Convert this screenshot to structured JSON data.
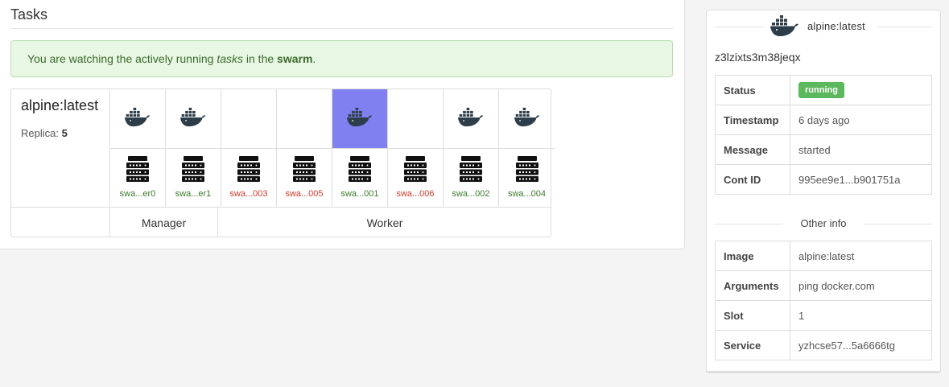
{
  "main": {
    "title": "Tasks",
    "alert": {
      "prefix": "You are watching the actively running ",
      "emphasis": "tasks",
      "middle": " in the ",
      "strong": "swarm",
      "suffix": "."
    }
  },
  "service": {
    "name": "alpine:latest",
    "replica_label": "Replica:",
    "replica_count": "5"
  },
  "nodes": [
    {
      "name": "swa...er0",
      "status": "green",
      "has_task": true,
      "selected": false
    },
    {
      "name": "swa...er1",
      "status": "green",
      "has_task": true,
      "selected": false
    },
    {
      "name": "swa...003",
      "status": "red",
      "has_task": false,
      "selected": false
    },
    {
      "name": "swa...005",
      "status": "red",
      "has_task": false,
      "selected": false
    },
    {
      "name": "swa...001",
      "status": "green",
      "has_task": true,
      "selected": true
    },
    {
      "name": "swa...006",
      "status": "red",
      "has_task": false,
      "selected": false
    },
    {
      "name": "swa...002",
      "status": "green",
      "has_task": true,
      "selected": false
    },
    {
      "name": "swa...004",
      "status": "green",
      "has_task": true,
      "selected": false
    }
  ],
  "roles": {
    "manager": "Manager",
    "worker": "Worker"
  },
  "details": {
    "image_name": "alpine:latest",
    "task_id": "z3lzixts3m38jeqx",
    "rows": [
      {
        "key": "Status",
        "value": "running",
        "badge": true
      },
      {
        "key": "Timestamp",
        "value": "6 days ago"
      },
      {
        "key": "Message",
        "value": "started"
      },
      {
        "key": "Cont ID",
        "value": "995ee9e1...b901751a"
      }
    ],
    "other_title": "Other info",
    "other_rows": [
      {
        "key": "Image",
        "value": "alpine:latest"
      },
      {
        "key": "Arguments",
        "value": "ping docker.com"
      },
      {
        "key": "Slot",
        "value": "1"
      },
      {
        "key": "Service",
        "value": "yzhcse57...5a6666tg"
      }
    ]
  },
  "colors": {
    "selected": "#8080f0",
    "node_up": "#3c7a2c",
    "node_down": "#d03a2a",
    "badge": "#5cb85c",
    "icon": "#2d3e4a"
  },
  "icons": {
    "task": "docker-whale-icon",
    "node": "server-icon"
  }
}
